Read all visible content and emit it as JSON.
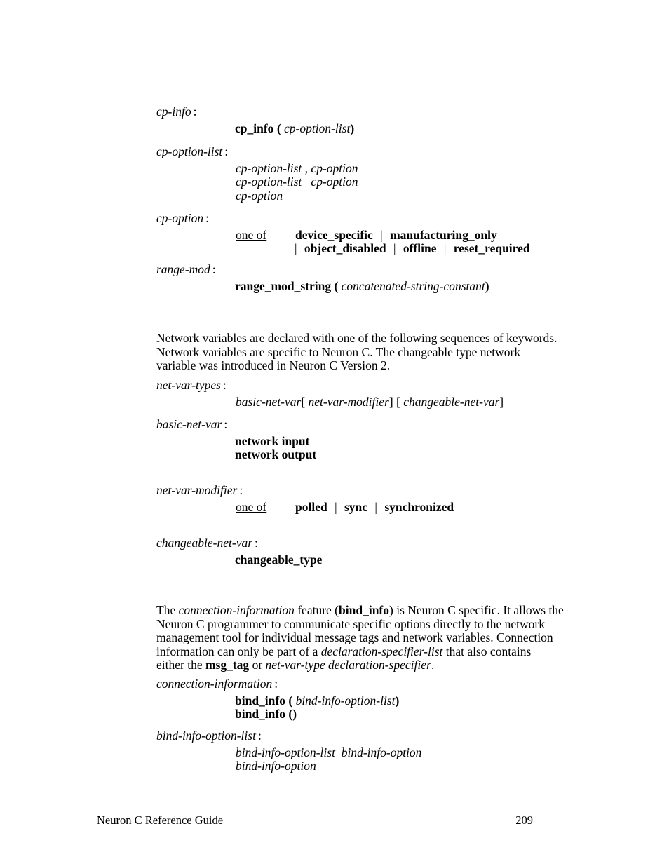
{
  "document": {
    "footer_title": "Neuron C Reference Guide",
    "page_number": "209"
  },
  "grammar_blocks": [
    {
      "name": "cp-info",
      "head": "cp-info",
      "colon": ":",
      "lines": [
        {
          "term": "cp_info",
          "open": "(",
          "arg": "cp-option-list",
          "close": ")"
        }
      ]
    },
    {
      "name": "cp-option-list",
      "head": "cp-option-list",
      "colon": ":",
      "lines": [
        {
          "a": "cp-option-list",
          "sep": ",",
          "b": "cp-option"
        },
        {
          "a": "cp-option-list",
          "sep": "",
          "b": "cp-option"
        },
        {
          "a": "cp-option"
        }
      ]
    },
    {
      "name": "cp-option",
      "head": "cp-option",
      "colon": ":",
      "oneof_label": "one of",
      "alt_line_1": "device_specific",
      "alt_line_1_b": "manufacturing_only",
      "alt_line_2_a": "object_disabled",
      "alt_line_2_b": "offline",
      "alt_line_2_c": "reset_required",
      "bar": "|"
    },
    {
      "name": "range-mod",
      "head": "range-mod",
      "colon": ":",
      "lines": [
        {
          "term": "range_mod_string",
          "open": "(",
          "arg": "concatenated-string-constant",
          "close": ")"
        }
      ]
    }
  ],
  "netvar_paragraph": {
    "line1": "Network variables are declared with one of the following sequences of keywords.",
    "line2": "Network variables are specific to Neuron C.  The changeable type network",
    "line3": "variable was introduced in Neuron C Version 2."
  },
  "netvar_blocks": {
    "net_var_types": {
      "head": "net-var-types",
      "colon": ":",
      "a": "basic-net-var",
      "br_open_1": "[",
      "b": "net-var-modifier",
      "br_close_1": "]",
      "br_open_2": "[",
      "c": "changeable-net-var",
      "br_close_2": "]"
    },
    "basic_net_var": {
      "head": "basic-net-var",
      "colon": ":",
      "line1": "network input",
      "line2": "network output"
    },
    "net_var_modifier": {
      "head": "net-var-modifier",
      "colon": ":",
      "oneof_label": "one of",
      "alt1": "polled",
      "alt2": "sync",
      "alt3": "synchronized",
      "bar": "|"
    },
    "changeable_net_var": {
      "head": "changeable-net-var",
      "colon": ":",
      "line1": "changeable_type"
    }
  },
  "bindinfo_paragraph": {
    "l1_a": "The ",
    "l1_b": "connection-information",
    "l1_c": " feature (",
    "l1_d": "bind_info",
    "l1_e": ") is Neuron C specific.  It allows the",
    "l2": "Neuron C programmer to communicate specific options directly to the network",
    "l3": "management tool for individual message tags and network variables.  Connection",
    "l4_a": "information can only be part of a ",
    "l4_b": "declaration-specifier-list",
    "l4_c": " that also contains",
    "l5_a": "either the ",
    "l5_b": "msg_tag",
    "l5_c": " or ",
    "l5_d": "net-var-type declaration-specifier",
    "l5_e": "."
  },
  "bindinfo_blocks": {
    "connection_information": {
      "head": "connection-information",
      "colon": ":",
      "line1": {
        "term": "bind_info",
        "open": "(",
        "arg": "bind-info-option-list",
        "close": ")"
      },
      "line2": {
        "term": "bind_info",
        "open": "(",
        "arg": "",
        "close": ")"
      }
    },
    "bind_info_option_list": {
      "head": "bind-info-option-list",
      "colon": ":",
      "line1_a": "bind-info-option-list",
      "line1_b": "bind-info-option",
      "line2_a": "bind-info-option"
    }
  }
}
